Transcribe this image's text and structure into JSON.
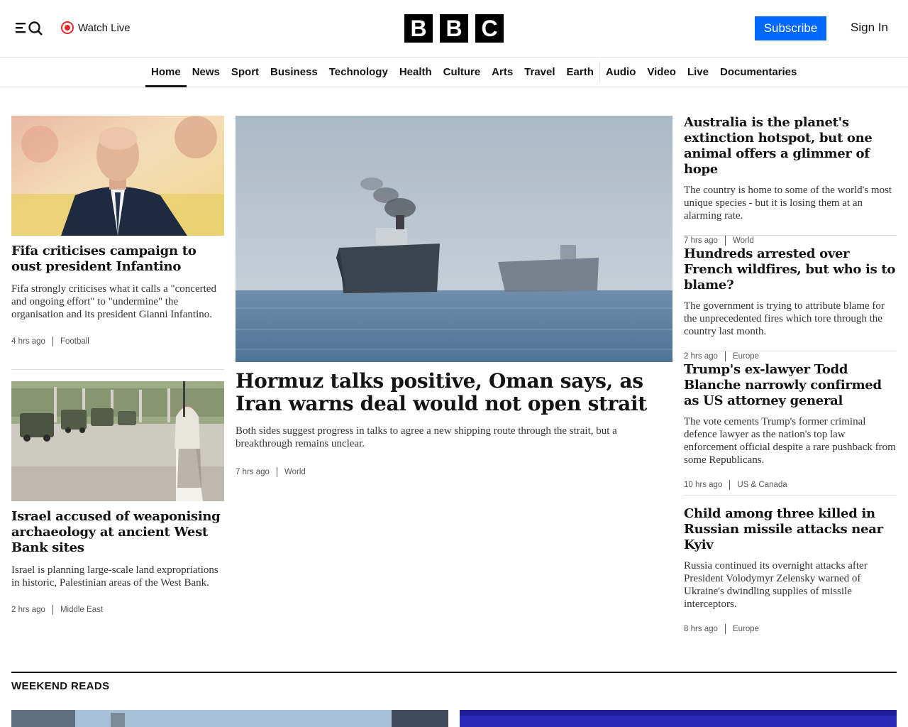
{
  "header": {
    "watch_live": "Watch Live",
    "logo_letters": [
      "B",
      "B",
      "C"
    ],
    "subscribe": "Subscribe",
    "sign_in": "Sign In"
  },
  "nav": {
    "items": [
      {
        "label": "Home",
        "active": true
      },
      {
        "label": "News"
      },
      {
        "label": "Sport"
      },
      {
        "label": "Business"
      },
      {
        "label": "Technology"
      },
      {
        "label": "Health"
      },
      {
        "label": "Culture"
      },
      {
        "label": "Arts"
      },
      {
        "label": "Travel"
      },
      {
        "label": "Earth"
      },
      {
        "label": "Audio"
      },
      {
        "label": "Video"
      },
      {
        "label": "Live"
      },
      {
        "label": "Documentaries"
      }
    ]
  },
  "left": {
    "story1": {
      "headline": "Fifa criticises campaign to oust president Infantino",
      "summary": "Fifa strongly criticises what it calls a \"concerted and ongoing effort\" to \"undermine\" the organisation and its president Gianni Infantino.",
      "time": "4 hrs ago",
      "category": "Football"
    },
    "story2": {
      "headline": "Israel accused of weaponising archaeology at ancient West Bank sites",
      "summary": "Israel is planning large-scale land expropriations in historic, Palestinian areas of the West Bank.",
      "time": "2 hrs ago",
      "category": "Middle East"
    }
  },
  "main": {
    "headline": "Hormuz talks positive, Oman says, as Iran warns deal would not open strait",
    "summary": "Both sides suggest progress in talks to agree a new shipping route through the strait, but a breakthrough remains unclear.",
    "time": "7 hrs ago",
    "category": "World"
  },
  "right": {
    "stories": [
      {
        "headline": "Australia is the planet's extinction hotspot, but one animal offers a glimmer of hope",
        "summary": "The country is home to some of the world's most unique species - but it is losing them at an alarming rate.",
        "time": "7 hrs ago",
        "category": "World"
      },
      {
        "headline": "Hundreds arrested over French wildfires, but who is to blame?",
        "summary": "The government is trying to attribute blame for the unprecedented fires which tore through the country last month.",
        "time": "2 hrs ago",
        "category": "Europe"
      },
      {
        "headline": "Trump's ex-lawyer Todd Blanche narrowly confirmed as US attorney general",
        "summary": "The vote cements Trump's former criminal defence lawyer as the nation's top law enforcement official despite a rare pushback from some Republicans.",
        "time": "10 hrs ago",
        "category": "US & Canada"
      },
      {
        "headline": "Child among three killed in Russian missile attacks near Kyiv",
        "summary": "Russia continued its overnight attacks after President Volodymyr Zelensky warned of Ukraine's dwindling supplies of missile interceptors.",
        "time": "8 hrs ago",
        "category": "Europe"
      }
    ]
  },
  "sections": {
    "weekend_reads": "WEEKEND READS"
  },
  "icons": {
    "menu": "menu-icon",
    "search": "search-icon",
    "live": "live-dot-icon"
  },
  "colors": {
    "subscribe_bg": "#0068ff",
    "live_red": "#e8292e",
    "text": "#141414"
  }
}
